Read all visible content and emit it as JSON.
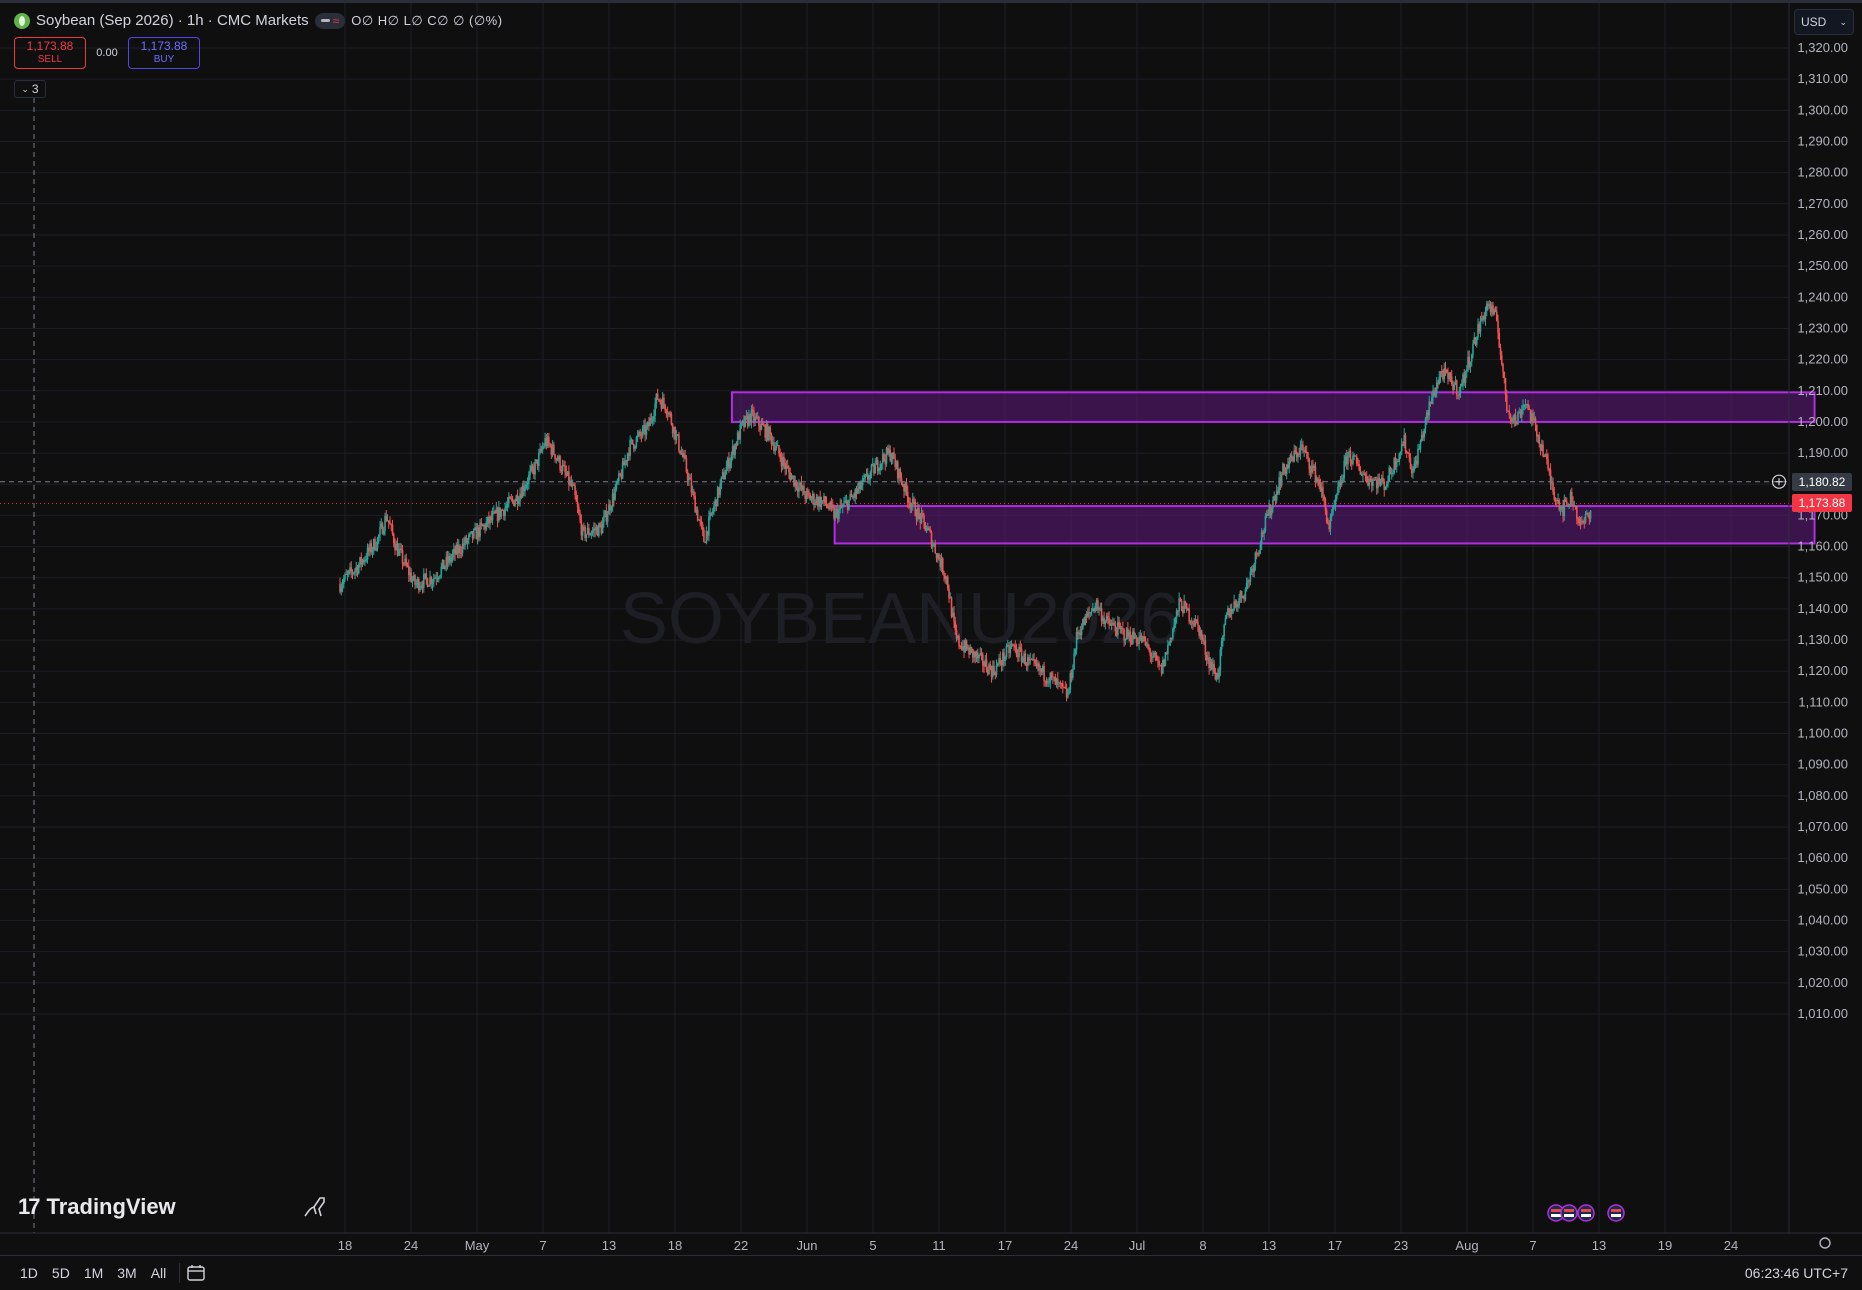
{
  "legend": {
    "title": "Soybean (Sep 2026) · 1h · CMC Markets",
    "ohlc": "O∅ H∅ L∅ C∅ ∅ (∅%)"
  },
  "trade": {
    "sell_price": "1,173.88",
    "sell_label": "SELL",
    "spread": "0.00",
    "buy_price": "1,173.88",
    "buy_label": "BUY"
  },
  "collapse_count": "3",
  "currency": "USD",
  "watermark": "SOYBEANU2026",
  "logo": "TradingView",
  "crosshair_price": "1,180.82",
  "last_price": "1,173.88",
  "clock": "06:23:46 UTC+7",
  "range_buttons": [
    "1D",
    "5D",
    "1M",
    "3M",
    "All"
  ],
  "colors": {
    "up": "#26a69a",
    "down": "#ef5350",
    "zone_fill": "#5e1a7a",
    "zone_border": "#b02ee0",
    "last_price_bg": "#f23645",
    "crosshair_tag_bg": "#363a45"
  },
  "chart_data": {
    "type": "candlestick",
    "y_ticks": [
      1010,
      1020,
      1030,
      1040,
      1050,
      1060,
      1070,
      1080,
      1090,
      1100,
      1110,
      1120,
      1130,
      1140,
      1150,
      1160,
      1170,
      1180,
      1190,
      1200,
      1210,
      1220,
      1230,
      1240,
      1250,
      1260,
      1270,
      1280,
      1290,
      1300,
      1310,
      1320
    ],
    "y_tick_labels": [
      "1,010.00",
      "1,020.00",
      "1,030.00",
      "1,040.00",
      "1,050.00",
      "1,060.00",
      "1,070.00",
      "1,080.00",
      "1,090.00",
      "1,100.00",
      "1,110.00",
      "1,120.00",
      "1,130.00",
      "1,140.00",
      "1,150.00",
      "1,160.00",
      "1,170.00",
      "1,180.00",
      "1,190.00",
      "1,200.00",
      "1,210.00",
      "1,220.00",
      "1,230.00",
      "1,240.00",
      "1,250.00",
      "1,260.00",
      "1,270.00",
      "1,280.00",
      "1,290.00",
      "1,300.00",
      "1,310.00",
      "1,320.00"
    ],
    "ylim": [
      1003,
      1325
    ],
    "x_ticks": [
      "18",
      "24",
      "May",
      "7",
      "13",
      "18",
      "22",
      "Jun",
      "5",
      "11",
      "17",
      "24",
      "Jul",
      "8",
      "13",
      "17",
      "23",
      "Aug",
      "7",
      "13",
      "19",
      "24"
    ],
    "path": [
      [
        0,
        1148
      ],
      [
        2,
        1154
      ],
      [
        4,
        1162
      ],
      [
        5,
        1170
      ],
      [
        6,
        1160
      ],
      [
        8,
        1148
      ],
      [
        10,
        1150
      ],
      [
        13,
        1160
      ],
      [
        16,
        1168
      ],
      [
        19,
        1176
      ],
      [
        21,
        1186
      ],
      [
        22,
        1194
      ],
      [
        23,
        1190
      ],
      [
        25,
        1178
      ],
      [
        26,
        1164
      ],
      [
        28,
        1166
      ],
      [
        30,
        1182
      ],
      [
        31,
        1192
      ],
      [
        33,
        1198
      ],
      [
        34,
        1208
      ],
      [
        35,
        1205
      ],
      [
        37,
        1186
      ],
      [
        39,
        1162
      ],
      [
        41,
        1182
      ],
      [
        43,
        1198
      ],
      [
        44,
        1202
      ],
      [
        46,
        1196
      ],
      [
        48,
        1184
      ],
      [
        50,
        1176
      ],
      [
        52,
        1174
      ],
      [
        53,
        1170
      ],
      [
        55,
        1176
      ],
      [
        58,
        1188
      ],
      [
        59,
        1190
      ],
      [
        61,
        1175
      ],
      [
        63,
        1165
      ],
      [
        65,
        1150
      ],
      [
        66,
        1130
      ],
      [
        68,
        1125
      ],
      [
        70,
        1120
      ],
      [
        72,
        1128
      ],
      [
        74,
        1122
      ],
      [
        76,
        1118
      ],
      [
        78,
        1112
      ],
      [
        79,
        1132
      ],
      [
        81,
        1142
      ],
      [
        82,
        1136
      ],
      [
        84,
        1132
      ],
      [
        86,
        1130
      ],
      [
        87,
        1125
      ],
      [
        88,
        1120
      ],
      [
        90,
        1142
      ],
      [
        92,
        1134
      ],
      [
        93,
        1124
      ],
      [
        94,
        1118
      ],
      [
        95,
        1138
      ],
      [
        97,
        1146
      ],
      [
        99,
        1166
      ],
      [
        101,
        1184
      ],
      [
        103,
        1192
      ],
      [
        105,
        1180
      ],
      [
        106,
        1166
      ],
      [
        108,
        1190
      ],
      [
        110,
        1182
      ],
      [
        112,
        1180
      ],
      [
        114,
        1194
      ],
      [
        115,
        1184
      ],
      [
        117,
        1208
      ],
      [
        118,
        1216
      ],
      [
        120,
        1210
      ],
      [
        122,
        1230
      ],
      [
        123,
        1238
      ],
      [
        124,
        1232
      ],
      [
        125,
        1205
      ],
      [
        126,
        1200
      ],
      [
        127,
        1207
      ],
      [
        129,
        1190
      ],
      [
        130,
        1178
      ],
      [
        131,
        1172
      ],
      [
        132,
        1176
      ],
      [
        133,
        1166
      ],
      [
        134,
        1172
      ]
    ],
    "zones": [
      {
        "name": "resistance",
        "x_start": 42,
        "x_end": 158,
        "top": 1209.5,
        "bottom": 1200
      },
      {
        "name": "support",
        "x_start": 53,
        "x_end": 158,
        "top": 1173,
        "bottom": 1161
      }
    ],
    "crosshair": {
      "price": 1180.82,
      "x": 2
    },
    "last_price": 1173.88
  }
}
